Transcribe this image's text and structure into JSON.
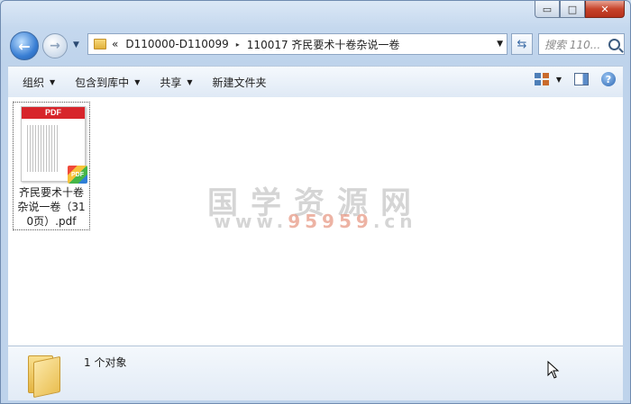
{
  "window": {
    "buttons": {
      "minimize": "▭",
      "maximize": "□",
      "close": "✕"
    }
  },
  "nav": {
    "back_icon": "back-arrow-icon",
    "forward_icon": "forward-arrow-icon",
    "address": {
      "overflow": "«",
      "parts": [
        "D110000-D110099",
        "110017 齐民要术十卷杂说一卷"
      ],
      "separator": "▸"
    },
    "search_placeholder": "搜索 110..."
  },
  "toolbar": {
    "organize": "组织",
    "include_library": "包含到库中",
    "share": "共享",
    "new_folder": "新建文件夹",
    "help": "?"
  },
  "files": [
    {
      "name": "齐民要术十卷杂说一卷（310页）.pdf",
      "type_badge": "PDF",
      "thumb_label": "PDF"
    }
  ],
  "watermark": {
    "line1": "国学资源网",
    "line2_prefix": "www.",
    "line2_highlight": "95959",
    "line2_suffix": ".cn"
  },
  "status": {
    "count_text": "1 个对象"
  },
  "colors": {
    "pdf_red": "#d7252b",
    "window_frame": "#c5d8ee"
  }
}
